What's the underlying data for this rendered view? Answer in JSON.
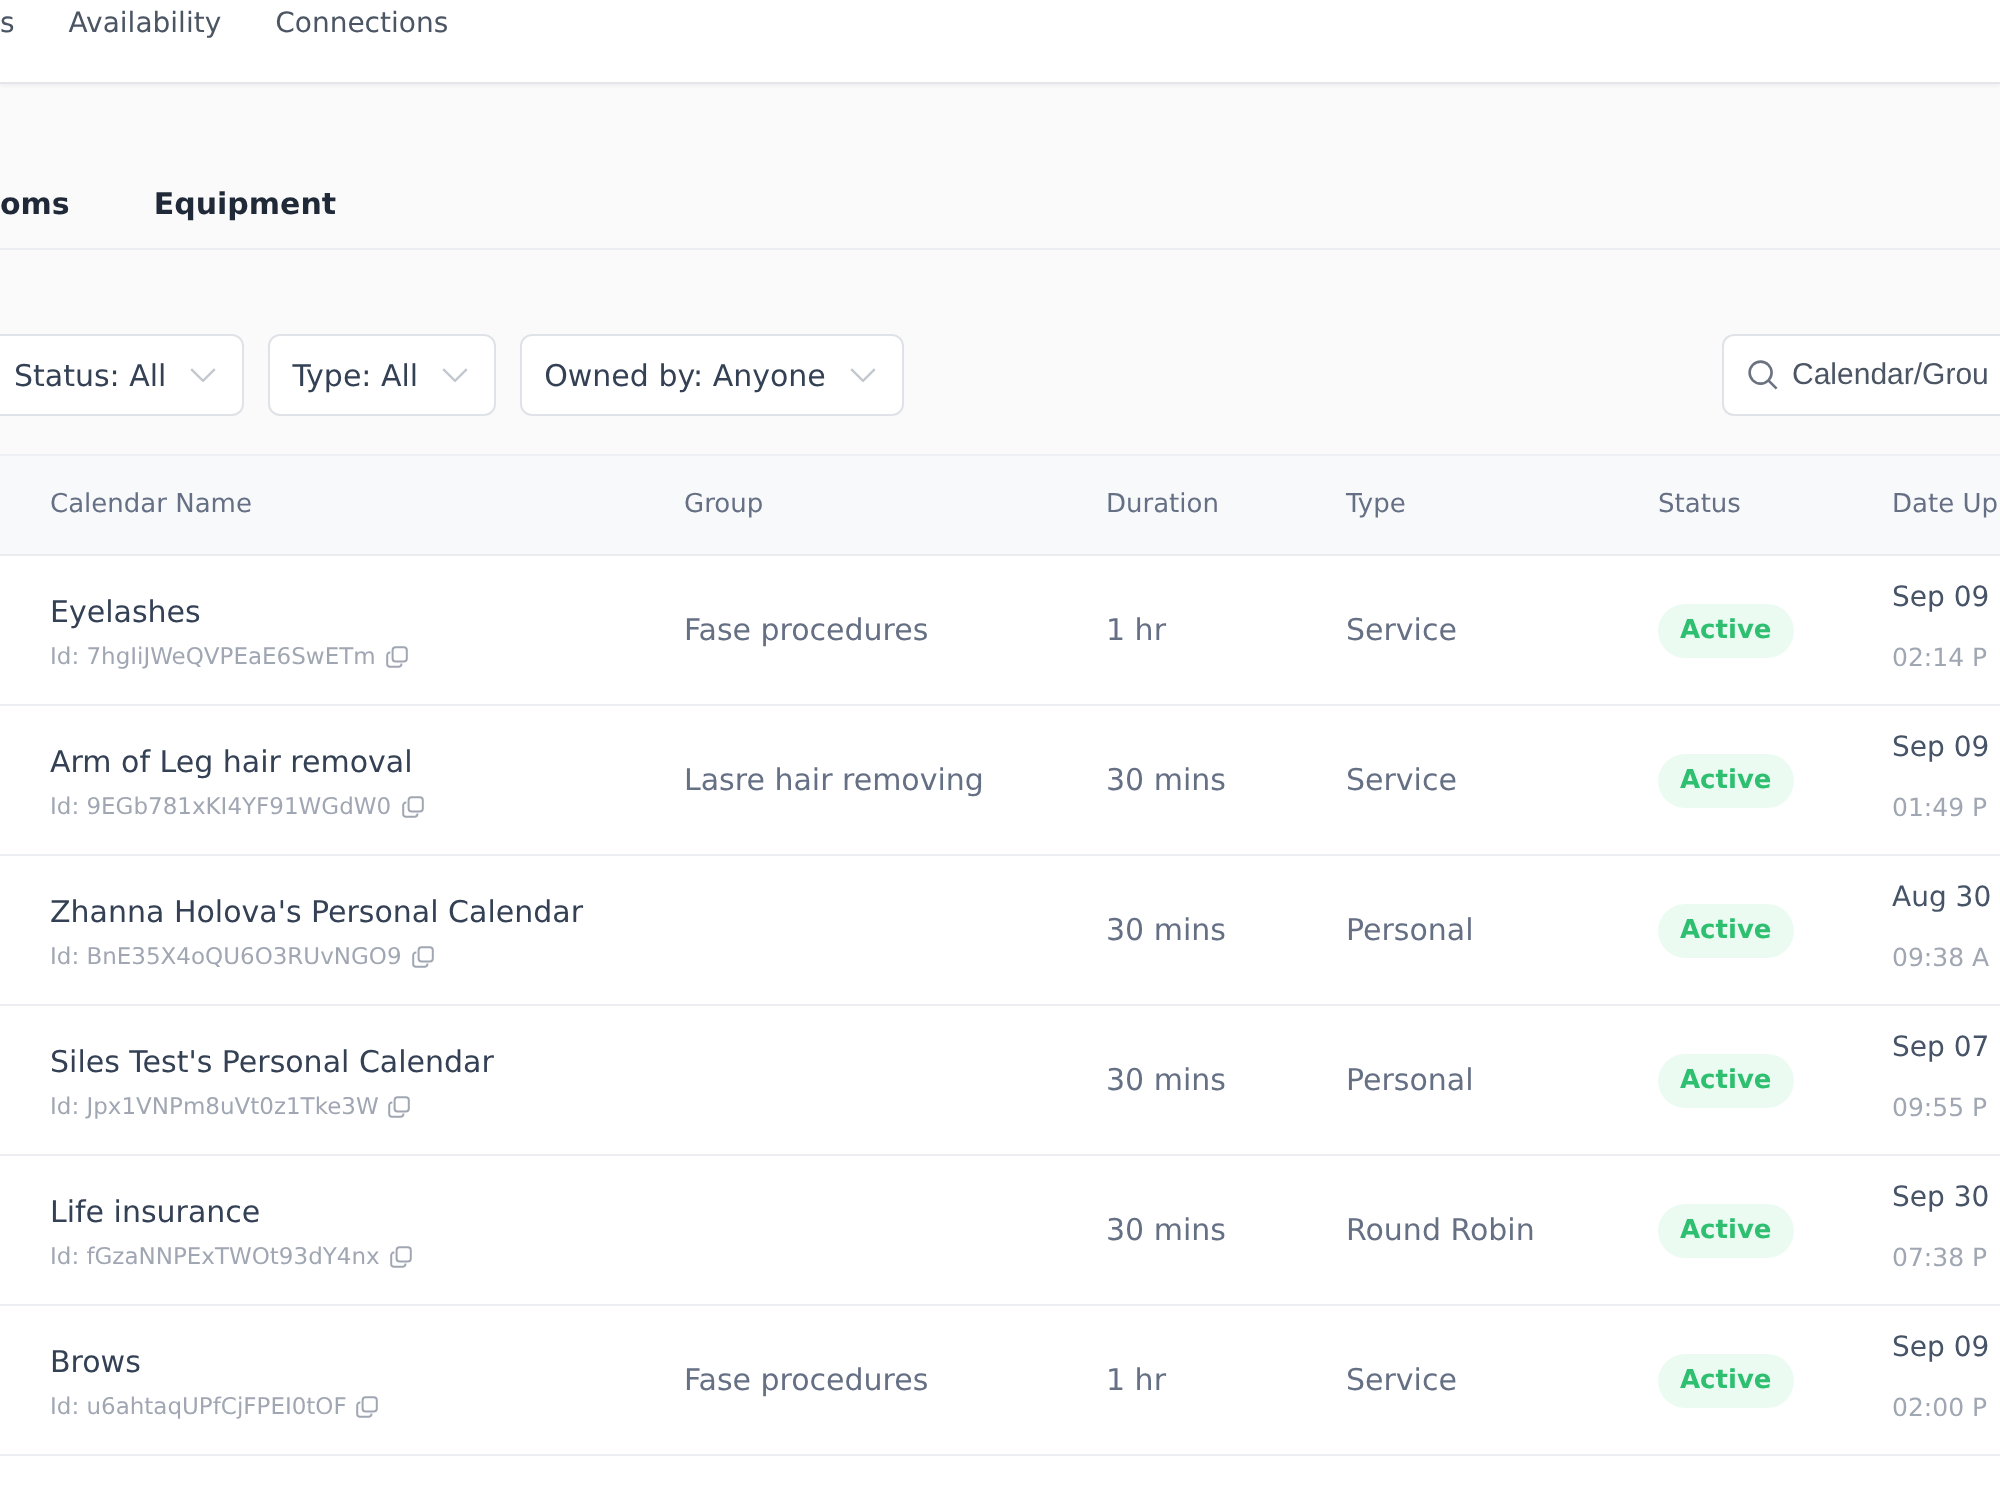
{
  "top_tabs": [
    {
      "label": "s"
    },
    {
      "label": "Availability"
    },
    {
      "label": "Connections"
    }
  ],
  "sub_tabs": [
    {
      "label": "oms"
    },
    {
      "label": "Equipment"
    }
  ],
  "filters": [
    {
      "label": "Status: All"
    },
    {
      "label": "Type: All"
    },
    {
      "label": "Owned by: Anyone"
    }
  ],
  "search": {
    "placeholder": "Calendar/Grou"
  },
  "table": {
    "columns": [
      "Calendar Name",
      "Group",
      "Duration",
      "Type",
      "Status",
      "Date Up"
    ],
    "rows": [
      {
        "name": "Eyelashes",
        "id": "Id: 7hgIiJWeQVPEaE6SwETm",
        "group": "Fase procedures",
        "duration": "1 hr",
        "type": "Service",
        "status": "Active",
        "date": "Sep 09",
        "time": "02:14 P"
      },
      {
        "name": "Arm of Leg hair removal",
        "id": "Id: 9EGb781xKI4YF91WGdW0",
        "group": "Lasre hair removing",
        "duration": "30 mins",
        "type": "Service",
        "status": "Active",
        "date": "Sep 09",
        "time": "01:49 P"
      },
      {
        "name": "Zhanna Holova's Personal Calendar",
        "id": "Id: BnE35X4oQU6O3RUvNGO9",
        "duration": "30 mins",
        "type": "Personal",
        "status": "Active",
        "date": "Aug 30",
        "time": "09:38 A"
      },
      {
        "name": "Siles Test's Personal Calendar",
        "id": "Id: Jpx1VNPm8uVt0z1Tke3W",
        "duration": "30 mins",
        "type": "Personal",
        "status": "Active",
        "date": "Sep 07",
        "time": "09:55 P"
      },
      {
        "name": "Life insurance",
        "id": "Id: fGzaNNPExTWOt93dY4nx",
        "duration": "30 mins",
        "type": "Round Robin",
        "status": "Active",
        "date": "Sep 30",
        "time": "07:38 P"
      },
      {
        "name": "Brows",
        "id": "Id: u6ahtaqUPfCjFPEI0tOF",
        "group": "Fase procedures",
        "duration": "1 hr",
        "type": "Service",
        "status": "Active",
        "date": "Sep 09",
        "time": "02:00 P"
      }
    ]
  }
}
